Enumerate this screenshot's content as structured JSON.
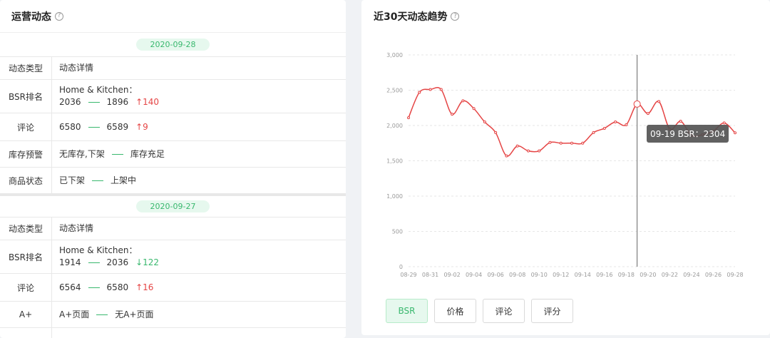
{
  "left": {
    "title": "运营动态",
    "groups": [
      {
        "date": "2020-09-28",
        "header": {
          "type": "动态类型",
          "detail": "动态详情"
        },
        "bsr": {
          "label": "BSR排名",
          "category": "Home & Kitchen：",
          "from": "2036",
          "to": "1896",
          "delta": "140"
        },
        "review": {
          "label": "评论",
          "from": "6580",
          "to": "6589",
          "delta": "9"
        },
        "stock": {
          "label": "库存预警",
          "from": "无库存,下架",
          "to": "库存充足"
        },
        "status": {
          "label": "商品状态",
          "from": "已下架",
          "to": "上架中"
        }
      },
      {
        "date": "2020-09-27",
        "header": {
          "type": "动态类型",
          "detail": "动态详情"
        },
        "bsr": {
          "label": "BSR排名",
          "category": "Home & Kitchen：",
          "from": "1914",
          "to": "2036",
          "delta": "122"
        },
        "review": {
          "label": "评论",
          "from": "6564",
          "to": "6580",
          "delta": "16"
        },
        "aplus": {
          "label": "A+",
          "from": "A+页面",
          "to": "无A+页面"
        }
      }
    ]
  },
  "right": {
    "title": "近30天动态趋势",
    "tooltip": "09-19 BSR：2304",
    "buttons": [
      "BSR",
      "价格",
      "评论",
      "评分"
    ],
    "active_button": "BSR"
  },
  "colors": {
    "accent": "#39b86e",
    "line": "#e54545"
  },
  "chart_data": {
    "type": "line",
    "x_ticks": [
      "08-29",
      "08-31",
      "09-02",
      "09-04",
      "09-06",
      "09-08",
      "09-10",
      "09-12",
      "09-14",
      "09-16",
      "09-18",
      "09-20",
      "09-22",
      "09-24",
      "09-26",
      "09-28"
    ],
    "y_ticks": [
      "0",
      "500",
      "1,000",
      "1,500",
      "2,000",
      "2,500",
      "3,000"
    ],
    "ylim": [
      0,
      3000
    ],
    "x": [
      "08-29",
      "08-30",
      "08-31",
      "09-01",
      "09-02",
      "09-03",
      "09-04",
      "09-05",
      "09-06",
      "09-07",
      "09-08",
      "09-09",
      "09-10",
      "09-11",
      "09-12",
      "09-13",
      "09-14",
      "09-15",
      "09-16",
      "09-17",
      "09-18",
      "09-19",
      "09-20",
      "09-21",
      "09-22",
      "09-23",
      "09-24",
      "09-25",
      "09-26",
      "09-27",
      "09-28"
    ],
    "series": [
      {
        "values": [
          2110,
          2470,
          2510,
          2510,
          2160,
          2350,
          2240,
          2050,
          1900,
          1570,
          1710,
          1640,
          1640,
          1760,
          1750,
          1750,
          1750,
          1900,
          1960,
          2050,
          2010,
          2304,
          2170,
          2340,
          1950,
          2060,
          1860,
          1870,
          1920,
          2036,
          1896
        ]
      }
    ],
    "highlight_index": 21
  }
}
